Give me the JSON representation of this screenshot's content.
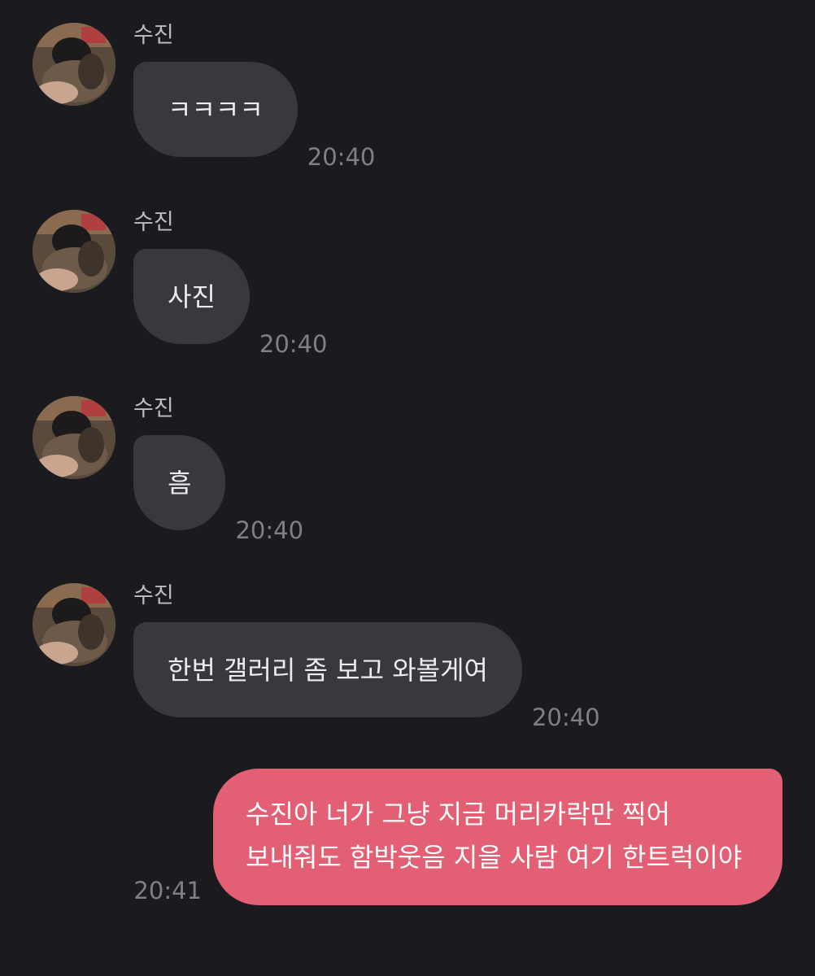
{
  "incoming": [
    {
      "sender": "수진",
      "text": "ㅋㅋㅋㅋ",
      "time": "20:40"
    },
    {
      "sender": "수진",
      "text": "사진",
      "time": "20:40"
    },
    {
      "sender": "수진",
      "text": "흠",
      "time": "20:40"
    },
    {
      "sender": "수진",
      "text": "한번 갤러리 좀 보고 와볼게여",
      "time": "20:40"
    }
  ],
  "outgoing": {
    "text": "수진아 너가 그냥 지금 머리카락만 찍어 보내줘도 함박웃음 지을 사람 여기 한트럭이야",
    "time": "20:41"
  },
  "colors": {
    "background": "#1b1b1f",
    "incoming_bubble": "#38383d",
    "outgoing_bubble": "#e25f74",
    "timestamp": "#7f7f86"
  },
  "icons": {
    "avatar": "profile-photo"
  }
}
